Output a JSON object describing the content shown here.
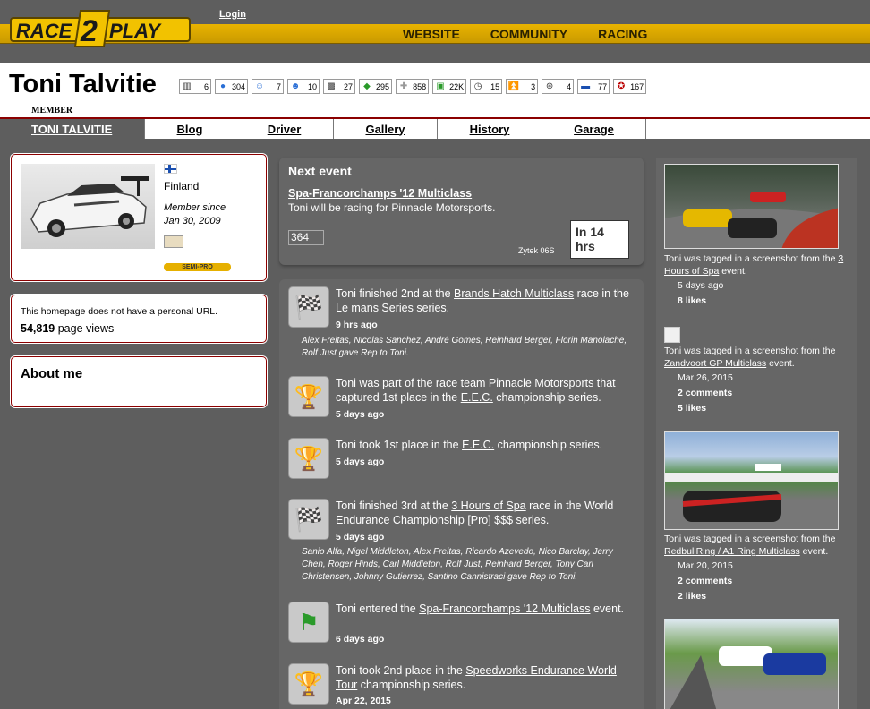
{
  "site": {
    "logo_left": "RACE",
    "logo_mid": "2",
    "logo_right": "PLAY",
    "login": "Login",
    "nav": [
      "WEBSITE",
      "COMMUNITY",
      "RACING"
    ]
  },
  "profile": {
    "name": "Toni Talvitie",
    "role": "MEMBER",
    "stats": [
      {
        "icon": "races-icon",
        "value": "6"
      },
      {
        "icon": "comments-icon",
        "value": "304"
      },
      {
        "icon": "friends-icon",
        "value": "7"
      },
      {
        "icon": "groups-icon",
        "value": "10"
      },
      {
        "icon": "checkered-icon",
        "value": "27"
      },
      {
        "icon": "laps-icon",
        "value": "295"
      },
      {
        "icon": "plus-icon",
        "value": "858"
      },
      {
        "icon": "km-icon",
        "value": "22K"
      },
      {
        "icon": "clock-icon",
        "value": "15"
      },
      {
        "icon": "rank-icon",
        "value": "3"
      },
      {
        "icon": "wheel-icon",
        "value": "4"
      },
      {
        "icon": "car-icon",
        "value": "77"
      },
      {
        "icon": "rep-icon",
        "value": "167"
      }
    ],
    "tabs": [
      "TONI TALVITIE",
      "Blog",
      "Driver",
      "Gallery",
      "History",
      "Garage"
    ]
  },
  "info": {
    "country": "Finland",
    "member_since_label": "Member since",
    "member_since_date": "Jan 30, 2009",
    "rank": "SEMI-PRO",
    "url_text": "This homepage does not have a personal URL.",
    "page_views": "54,819",
    "page_views_label": "page views",
    "about_title": "About me"
  },
  "next_event": {
    "title": "Next event",
    "event_link": "Spa-Francorchamps '12 Multiclass",
    "team_text": "Toni will be racing for Pinnacle Motorsports.",
    "car_alt": "364",
    "car": "Zytek 06S",
    "countdown": "In 14 hrs"
  },
  "feed": [
    {
      "pre": "Toni finished 2nd at the ",
      "link": "Brands Hatch Multiclass",
      "post": " race in the Le mans Series series.",
      "time": "9 hrs ago",
      "sub": "Alex Freitas, Nicolas Sanchez, André Gomes, Reinhard Berger, Florin Manolache, Rolf Just gave Rep to Toni."
    },
    {
      "pre": "Toni was part of the race team Pinnacle Motorsports that captured 1st place in the ",
      "link": "E.E.C.",
      "post": " championship series.",
      "time": "5 days ago",
      "sub": ""
    },
    {
      "pre": "Toni took 1st place in the ",
      "link": "E.E.C.",
      "post": " championship series.",
      "time": "5 days ago",
      "sub": ""
    },
    {
      "pre": "Toni finished 3rd at the ",
      "link": "3 Hours of Spa",
      "post": " race in the World Endurance Championship [Pro] $$$ series.",
      "time": "5 days ago",
      "sub": "Sanio Alfa, Nigel Middleton, Alex Freitas, Ricardo Azevedo, Nico Barclay, Jerry Chen, Roger Hinds, Carl Middleton, Rolf Just, Reinhard Berger, Tony Carl Christensen, Johnny Gutierrez, Santino Cannistraci gave Rep to Toni."
    },
    {
      "pre": "Toni entered the ",
      "link": "Spa-Francorchamps '12 Multiclass",
      "post": " event.",
      "time": "6 days ago",
      "sub": ""
    },
    {
      "pre": "Toni took 2nd place in the ",
      "link": "Speedworks Endurance World Tour",
      "post": " championship series.",
      "time": "Apr 22, 2015",
      "sub": ""
    }
  ],
  "screenshots": [
    {
      "pre": "Toni was tagged in a screenshot from the ",
      "link": "3 Hours of Spa",
      "post": " event.",
      "date": "5 days ago",
      "comments": "",
      "likes": "8 likes"
    },
    {
      "pre": "Toni was tagged in a screenshot from the ",
      "link": "Zandvoort GP Multiclass",
      "post": " event.",
      "date": "Mar 26, 2015",
      "comments": "2 comments",
      "likes": "5 likes"
    },
    {
      "pre": "Toni was tagged in a screenshot from the ",
      "link": "RedbullRing / A1 Ring Multiclass",
      "post": " event.",
      "date": "Mar 20, 2015",
      "comments": "2 comments",
      "likes": "2 likes"
    }
  ]
}
